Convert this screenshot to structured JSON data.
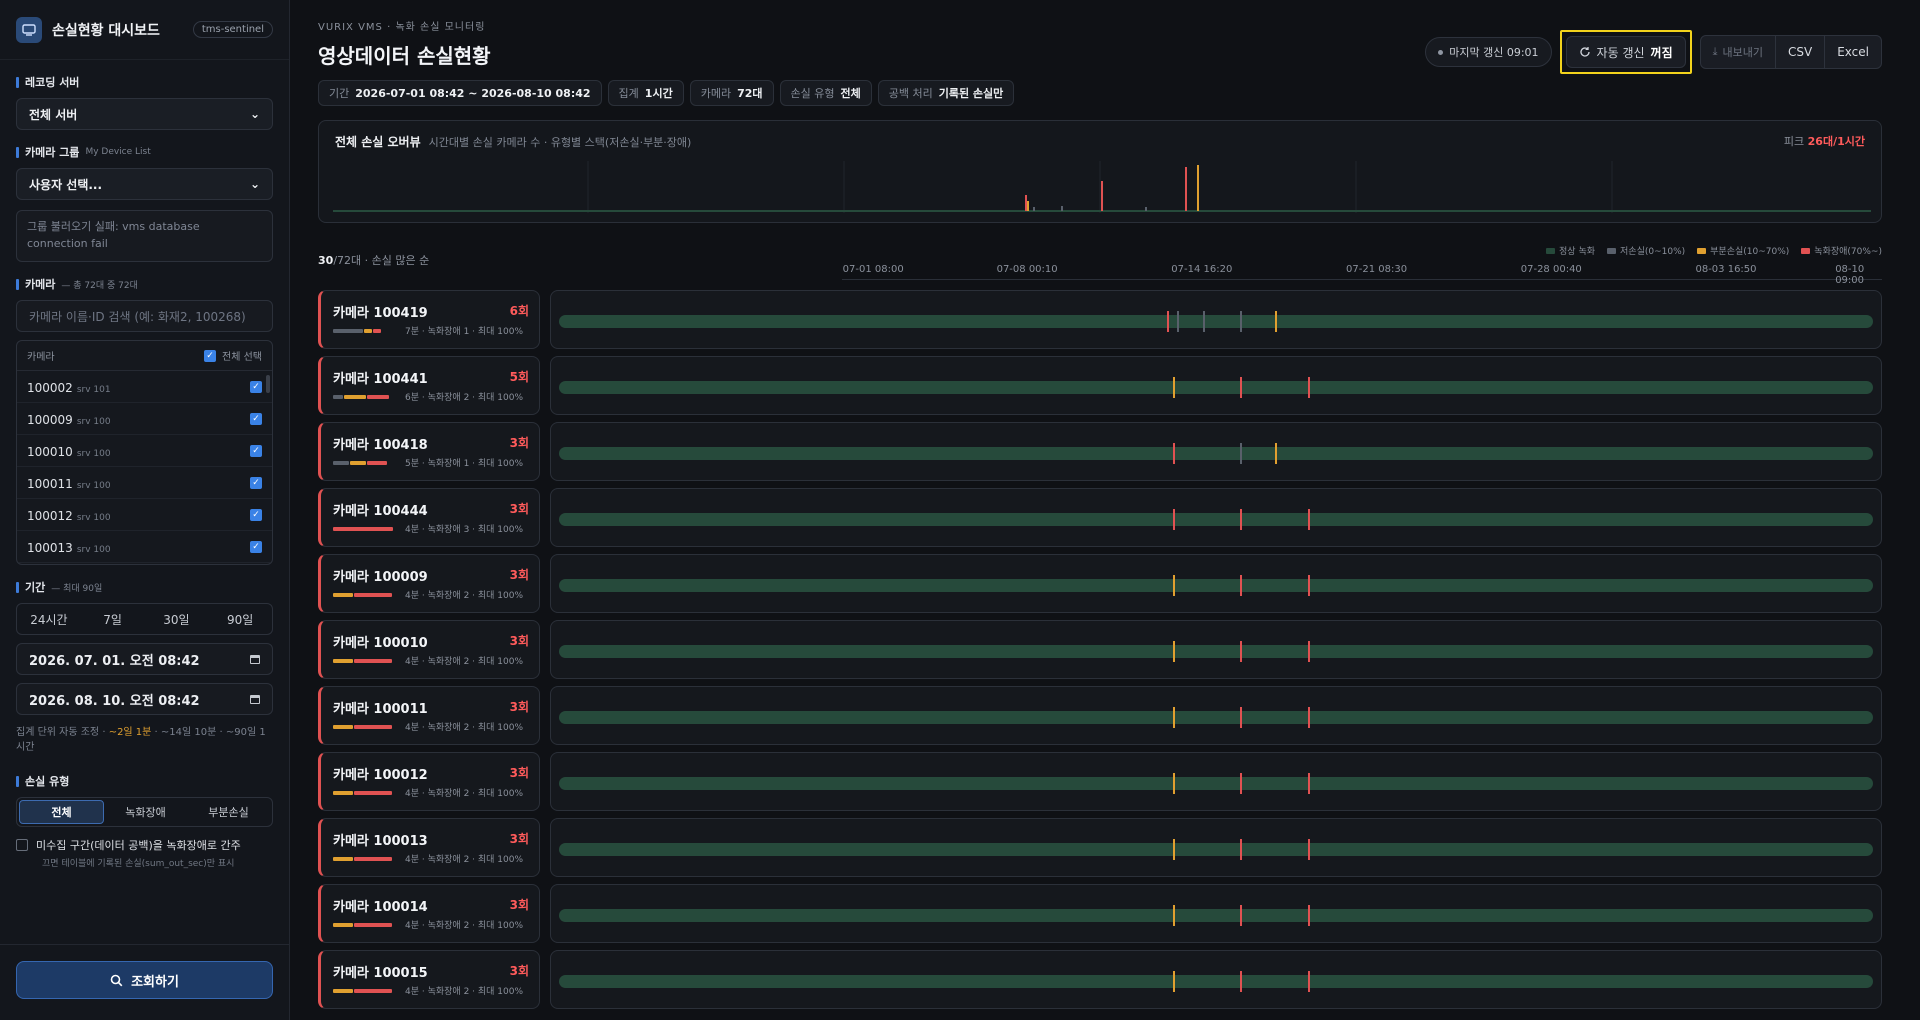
{
  "sidebar": {
    "title": "손실현황 대시보드",
    "env": "tms-sentinel",
    "server_label": "레코딩 서버",
    "server_value": "전체 서버",
    "group_label": "카메라 그룹",
    "group_sub": "My Device List",
    "group_value": "사용자 선택...",
    "group_error": "그룹 불러오기 실패: vms database connection fail",
    "camera_label": "카메라",
    "camera_sub": "— 총 72대 중 72대",
    "camera_search_placeholder": "카메라 이름·ID 검색 (예: 화재2, 100268)",
    "camera_col": "카메라",
    "select_all": "전체 선택",
    "cameras": [
      {
        "id": "100002",
        "srv": "srv 101"
      },
      {
        "id": "100009",
        "srv": "srv 100"
      },
      {
        "id": "100010",
        "srv": "srv 100"
      },
      {
        "id": "100011",
        "srv": "srv 100"
      },
      {
        "id": "100012",
        "srv": "srv 100"
      },
      {
        "id": "100013",
        "srv": "srv 100"
      }
    ],
    "period_label": "기간",
    "period_sub": "— 최대 90일",
    "period_options": [
      "24시간",
      "7일",
      "30일",
      "90일"
    ],
    "date_from": "2026. 07. 01. 오전 08:42",
    "date_to": "2026. 08. 10. 오전 08:42",
    "agg_note_prefix": "집계 단위 자동 조정 · ",
    "agg_note_hl": "~2일 1분",
    "agg_note_suffix": " · ~14일 10분 · ~90일 1시간",
    "loss_type_label": "손실 유형",
    "loss_types": [
      "전체",
      "녹화장애",
      "부분손실"
    ],
    "gap_option": "미수집 구간(데이터 공백)을 녹화장애로 간주",
    "gap_note": "끄면 테이블에 기록된 손실(sum_out_sec)만 표시",
    "query_button": "조회하기"
  },
  "header": {
    "kicker": "VURIX VMS · 녹화 손실 모니터링",
    "title": "영상데이터 손실현황",
    "last_update": "마지막 갱신 09:01",
    "auto_refresh_label": "자동 갱신",
    "auto_refresh_state": "꺼짐",
    "export_label": "내보내기",
    "csv": "CSV",
    "excel": "Excel"
  },
  "chips": [
    {
      "k": "기간",
      "v": "2026-07-01 08:42 ~ 2026-08-10 08:42"
    },
    {
      "k": "집계",
      "v": "1시간"
    },
    {
      "k": "카메라",
      "v": "72대"
    },
    {
      "k": "손실 유형",
      "v": "전체"
    },
    {
      "k": "공백 처리",
      "v": "기록된 손실만"
    }
  ],
  "overview": {
    "title": "전체 손실 오버뷰",
    "subtitle": "시간대별 손실 카메라 수 · 유형별 스택(저손실·부분·장애)",
    "peak_label": "피크",
    "peak_value": "26대/1시간"
  },
  "legend": [
    "정상 녹화",
    "저손실(0~10%)",
    "부분손실(10~70%)",
    "녹화장애(70%~)"
  ],
  "list_count": "30",
  "list_count_suffix": "/72대 · 손실 많은 순",
  "axis_ticks": [
    "07-01 08:00",
    "07-08 00:10",
    "07-14 16:20",
    "07-21 08:30",
    "07-28 00:40",
    "08-03 16:50",
    "08-10 09:00"
  ],
  "rows": [
    {
      "name": "카메라 100419",
      "count": "6회",
      "sub": "7분 · 녹화장애 1 · 최대 100%"
    },
    {
      "name": "카메라 100441",
      "count": "5회",
      "sub": "6분 · 녹화장애 2 · 최대 100%"
    },
    {
      "name": "카메라 100418",
      "count": "3회",
      "sub": "5분 · 녹화장애 1 · 최대 100%"
    },
    {
      "name": "카메라 100444",
      "count": "3회",
      "sub": "4분 · 녹화장애 3 · 최대 100%"
    },
    {
      "name": "카메라 100009",
      "count": "3회",
      "sub": "4분 · 녹화장애 2 · 최대 100%"
    },
    {
      "name": "카메라 100010",
      "count": "3회",
      "sub": "4분 · 녹화장애 2 · 최대 100%"
    },
    {
      "name": "카메라 100011",
      "count": "3회",
      "sub": "4분 · 녹화장애 2 · 최대 100%"
    },
    {
      "name": "카메라 100012",
      "count": "3회",
      "sub": "4분 · 녹화장애 2 · 최대 100%"
    },
    {
      "name": "카메라 100013",
      "count": "3회",
      "sub": "4분 · 녹화장애 2 · 최대 100%"
    },
    {
      "name": "카메라 100014",
      "count": "3회",
      "sub": "4분 · 녹화장애 2 · 최대 100%"
    },
    {
      "name": "카메라 100015",
      "count": "3회",
      "sub": "4분 · 녹화장애 2 · 최대 100%"
    }
  ],
  "colors": {
    "normal": "#264a3b",
    "low": "#59606b",
    "partial": "#e0a030",
    "outage": "#e05252",
    "accent": "#3d7bd9"
  }
}
